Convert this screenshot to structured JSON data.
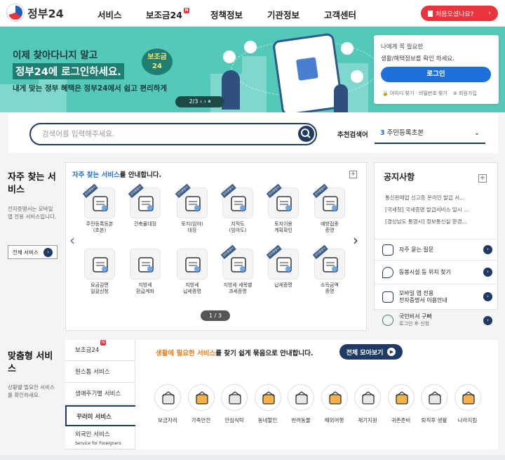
{
  "header": {
    "logo_text": "정부24",
    "nav": [
      "서비스",
      "보조금24",
      "정책정보",
      "기관정보",
      "고객센터"
    ],
    "new_badge": "N",
    "first_visit": "처음오셨나요?"
  },
  "hero": {
    "line1": "이제 찾아다니지 말고",
    "line2": "정부24에 로그인하세요.",
    "line3": "내게 맞는 정부 혜택은 정부24에서 쉽고 편리하게",
    "badge": "보조금 24",
    "pager": "2/3  ‹  ›  ⏸"
  },
  "login": {
    "text1": "나에게 꼭 필요한",
    "text2": "생활/혜택정보를 확인 하세요.",
    "button": "로그인",
    "links": [
      "아이디 찾기 · 비밀번호 찾기",
      "회원가입"
    ]
  },
  "search": {
    "placeholder": "검색어를 입력해주세요.",
    "rec_label": "추천검색어",
    "rec_num": "3",
    "rec_value": "주민등록초본"
  },
  "freq": {
    "side_title": "자주 찾는 서비스",
    "side_desc": "전자증명서는 모바일 앱 전용 서비스입니다.",
    "all_btn": "전체 서비스",
    "title_b": "자주 찾는 서비스",
    "title_rest": "를 안내합니다.",
    "pager": "1 / 3",
    "items": [
      {
        "l1": "주민등록등본",
        "l2": "(초본)"
      },
      {
        "l1": "건축물대장",
        "l2": ""
      },
      {
        "l1": "토지(임야)",
        "l2": "대장"
      },
      {
        "l1": "지적도",
        "l2": "(임야도)"
      },
      {
        "l1": "토지이용",
        "l2": "계획확인"
      },
      {
        "l1": "예방접종",
        "l2": "증명"
      },
      {
        "l1": "요금감면",
        "l2": "일괄신청"
      },
      {
        "l1": "지방세",
        "l2": "환급계좌"
      },
      {
        "l1": "지방세",
        "l2": "납세증명"
      },
      {
        "l1": "지방세 세목별",
        "l2": "과세증명"
      },
      {
        "l1": "납세증명",
        "l2": ""
      },
      {
        "l1": "소득금액",
        "l2": "증명"
      }
    ],
    "ribbon": "전자증명서"
  },
  "notice": {
    "title": "공지사항",
    "items": [
      "통신판매업 신고증 온라인 발급 서...",
      "[국세청] 국세증명 발급서비스 일시 ...",
      "[경상남도 통영시] 정보통신실 환경..."
    ],
    "quick": [
      {
        "t1": "자주 묻는 질문",
        "t2": ""
      },
      {
        "t1": "동봉시설 등 위치 찾기",
        "t2": ""
      },
      {
        "t1": "모바일 앱 전용",
        "t2": "전자증명서 이용안내"
      },
      {
        "t1": "국민비서 구삐",
        "t2": "로그인 후 신청"
      }
    ]
  },
  "custom": {
    "side_title": "맞춤형 서비스",
    "side_desc": "상황별 필요한 서비스를 확인하세요.",
    "tabs": [
      "보조금24",
      "원스톱 서비스",
      "생애주기별 서비스",
      "꾸러미 서비스",
      "외국인 서비스"
    ],
    "tab_sub": "Service for Foreigners",
    "title_b": "생활에 필요한 서비스",
    "title_rest": "를 찾기 쉽게 묶음으로 안내합니다.",
    "all_view": "전체 모아보기",
    "items": [
      "보금자리",
      "가족안전",
      "안심식탁",
      "동네할인",
      "반려동물",
      "해외여행",
      "재기지원",
      "귀촌준비",
      "퇴직후 생활",
      "나라지킴"
    ]
  },
  "colors": {
    "primary": "#1f3a63",
    "accent": "#e8343d",
    "hero": "#55c9b9",
    "link": "#1e6fd9",
    "orange": "#f07a18"
  }
}
